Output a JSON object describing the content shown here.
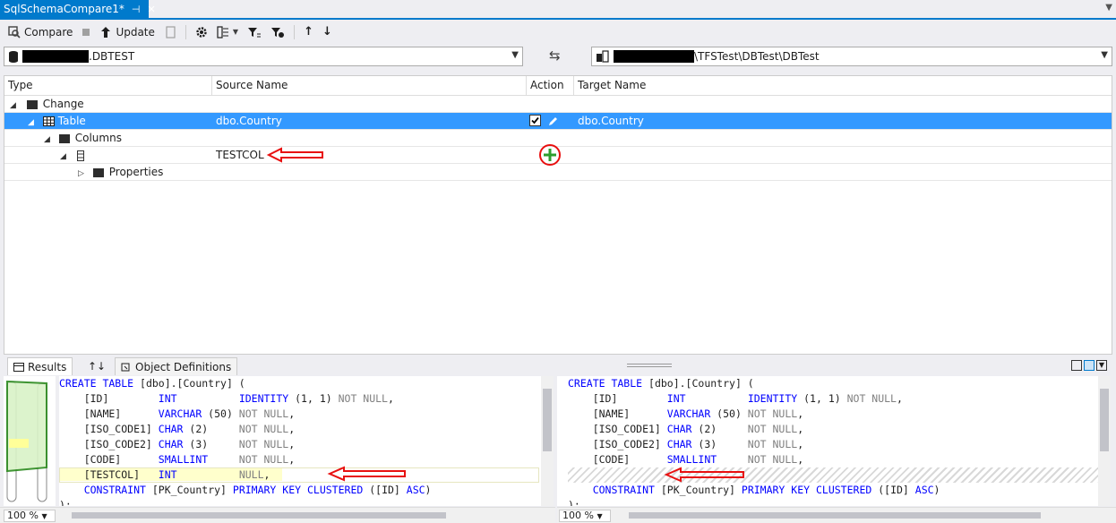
{
  "doc_tab": {
    "title": "SqlSchemaCompare1*",
    "pin": "⊣",
    "close": "✕"
  },
  "toolbar": {
    "compare_label": "Compare",
    "update_label": "Update"
  },
  "source": {
    "suffix": ".DBTEST"
  },
  "target": {
    "suffix": "\\TFSTest\\DBTest\\DBTest"
  },
  "swap_icon": "⇆",
  "grid": {
    "headers": {
      "type": "Type",
      "source": "Source Name",
      "action": "Action",
      "target": "Target Name"
    },
    "rows": {
      "change": "Change",
      "table_type": "Table",
      "table_source": "dbo.Country",
      "table_target": "dbo.Country",
      "columns": "Columns",
      "col_source": "TESTCOL",
      "properties": "Properties"
    }
  },
  "bottom": {
    "results_tab": "Results",
    "sort_tab": "↑↓",
    "objdef_tab": "Object Definitions",
    "zoom_left": "100 %",
    "zoom_right": "100 %"
  },
  "colors": {
    "accent": "#007acc",
    "selection": "#3399ff",
    "annotation": "#e81010",
    "add": "#2e9e2e"
  }
}
